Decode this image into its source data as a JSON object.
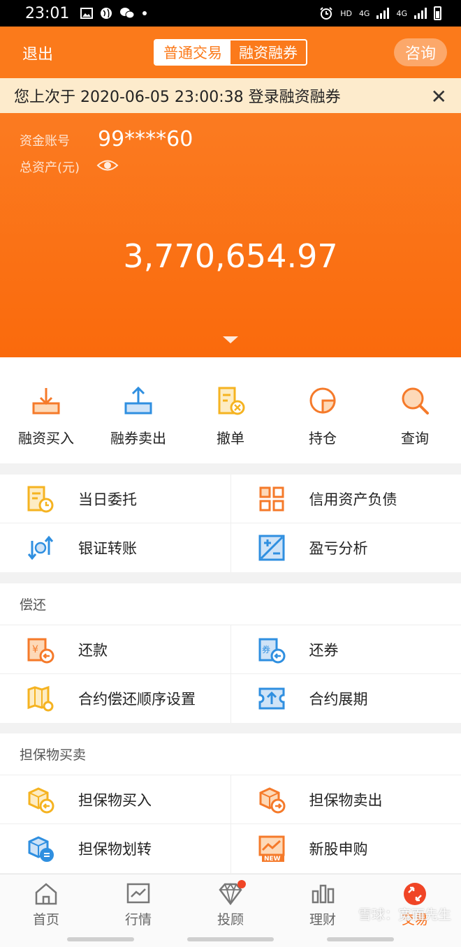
{
  "status_bar": {
    "time": "23:01",
    "network_hd": "HD",
    "network_4g_1": "4G",
    "network_4g_2": "4G",
    "icons": [
      "image-icon",
      "globe-icon",
      "wechat-icon",
      "dot-icon",
      "alarm-icon",
      "battery-icon"
    ]
  },
  "header": {
    "exit_label": "退出",
    "tab_normal": "普通交易",
    "tab_margin": "融资融券",
    "consult_label": "咨询"
  },
  "notice": {
    "text": "您上次于 2020-06-05 23:00:38 登录融资融券",
    "close": "✕"
  },
  "account": {
    "account_label": "资金账号",
    "account_value": "99****60",
    "assets_label": "总资产(元)",
    "total_assets": "3,770,654.97"
  },
  "quick_actions": [
    {
      "label": "融资买入",
      "icon": "download-tray-icon"
    },
    {
      "label": "融券卖出",
      "icon": "upload-tray-icon"
    },
    {
      "label": "撤单",
      "icon": "cancel-order-icon"
    },
    {
      "label": "持仓",
      "icon": "pie-chart-icon"
    },
    {
      "label": "查询",
      "icon": "magnifier-icon"
    }
  ],
  "section_main": [
    {
      "label": "当日委托",
      "icon": "document-clock-icon"
    },
    {
      "label": "信用资产负债",
      "icon": "grid-squares-icon"
    },
    {
      "label": "银证转账",
      "icon": "transfer-icon"
    },
    {
      "label": "盈亏分析",
      "icon": "plus-minus-icon"
    }
  ],
  "section_repay": {
    "title": "偿还",
    "items": [
      {
        "label": "还款",
        "icon": "repay-money-icon"
      },
      {
        "label": "还券",
        "icon": "repay-stock-icon"
      },
      {
        "label": "合约偿还顺序设置",
        "icon": "map-gear-icon"
      },
      {
        "label": "合约展期",
        "icon": "ticket-up-icon"
      }
    ]
  },
  "section_collateral": {
    "title": "担保物买卖",
    "items": [
      {
        "label": "担保物买入",
        "icon": "box-buy-icon"
      },
      {
        "label": "担保物卖出",
        "icon": "box-sell-icon"
      },
      {
        "label": "担保物划转",
        "icon": "box-transfer-icon"
      },
      {
        "label": "新股申购",
        "icon": "new-stock-icon"
      }
    ]
  },
  "new_badge": "NEW",
  "yen_mark": "¥",
  "quan_mark": "券",
  "bottom_nav": [
    {
      "label": "首页",
      "icon": "home-icon"
    },
    {
      "label": "行情",
      "icon": "chart-icon"
    },
    {
      "label": "投顾",
      "icon": "diamond-icon"
    },
    {
      "label": "理财",
      "icon": "bars-icon"
    },
    {
      "label": "交易",
      "icon": "trade-icon"
    }
  ],
  "watermark": "雪球：宽面先生",
  "colors": {
    "brand": "#fb7a1b",
    "blue": "#2f8fe0",
    "yellow": "#f5b321",
    "red": "#f04526"
  }
}
